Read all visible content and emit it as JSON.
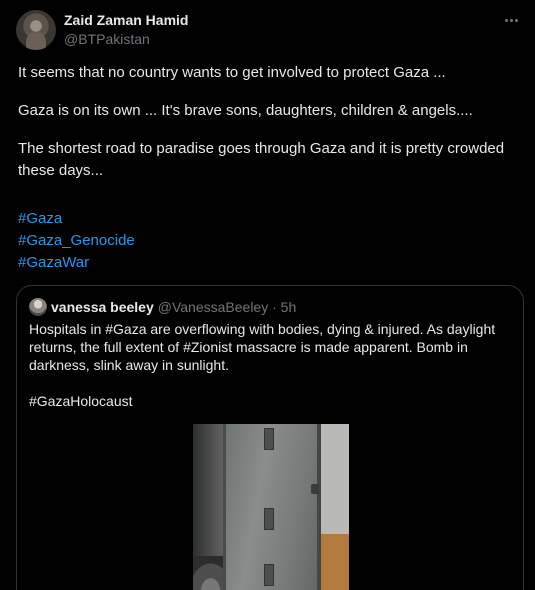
{
  "author": {
    "name": "Zaid Zaman Hamid",
    "handle": "@BTPakistan"
  },
  "tweet": {
    "paragraphs": [
      "It seems that no country wants to get involved to protect Gaza ...",
      "Gaza is on its own ... It's brave sons, daughters, children & angels....",
      "The shortest road to paradise goes through Gaza and it is pretty crowded these days..."
    ],
    "hashtags": [
      "#Gaza",
      "#Gaza_Genocide",
      "#GazaWar"
    ]
  },
  "quoted": {
    "name": "vanessa beeley",
    "handle_time": "@VanessaBeeley · 5h",
    "text": "Hospitals in #Gaza are overflowing with bodies, dying & injured. As daylight returns, the full extent of #Zionist massacre is made apparent.  Bomb in darkness, slink away in sunlight.",
    "hashtag": "#GazaHolocaust"
  },
  "icons": {
    "more": "more-horizontal-icon"
  }
}
